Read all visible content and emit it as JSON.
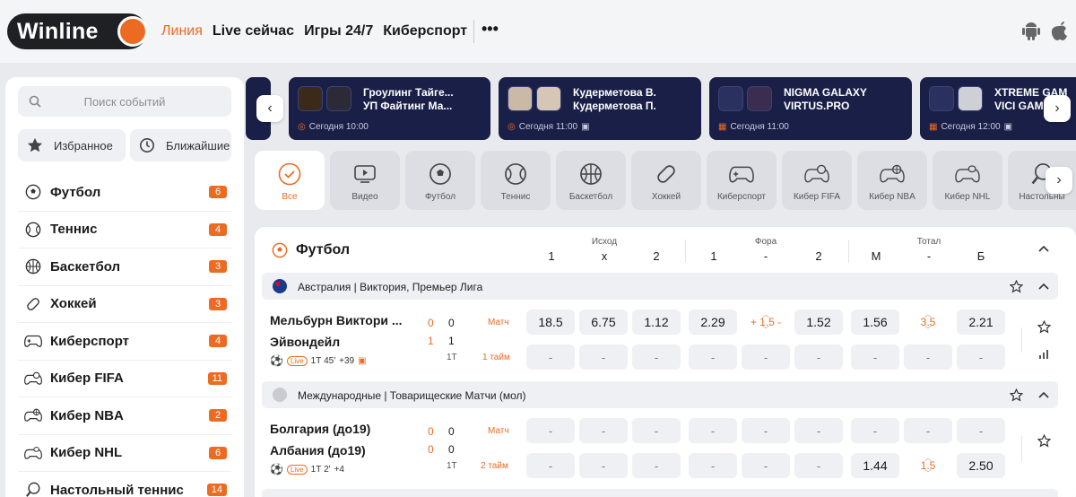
{
  "header": {
    "logo": "Winline",
    "nav": [
      {
        "label": "Линия",
        "active": true
      },
      {
        "label": "Live сейчас",
        "active": false
      },
      {
        "label": "Игры 24/7",
        "active": false
      },
      {
        "label": "Киберспорт",
        "active": false
      }
    ],
    "more": "•••",
    "accent": "#ec6b23"
  },
  "sidebar": {
    "search_placeholder": "Поиск событий",
    "favorites": "Избранное",
    "upcoming": "Ближайшие",
    "sports": [
      {
        "label": "Футбол",
        "count": "6",
        "icon": "soccer-ball-icon"
      },
      {
        "label": "Теннис",
        "count": "4",
        "icon": "tennis-ball-icon"
      },
      {
        "label": "Баскетбол",
        "count": "3",
        "icon": "basketball-icon"
      },
      {
        "label": "Хоккей",
        "count": "3",
        "icon": "hockey-puck-icon"
      },
      {
        "label": "Киберспорт",
        "count": "4",
        "icon": "gamepad-icon"
      },
      {
        "label": "Кибер FIFA",
        "count": "11",
        "icon": "cyber-fifa-icon"
      },
      {
        "label": "Кибер NBA",
        "count": "2",
        "icon": "cyber-nba-icon"
      },
      {
        "label": "Кибер NHL",
        "count": "6",
        "icon": "cyber-nhl-icon"
      },
      {
        "label": "Настольный теннис",
        "count": "14",
        "icon": "table-tennis-icon"
      }
    ]
  },
  "top_events": [
    {
      "line1": "Гроулинг Тайге...",
      "line2": "УП Файтинг Ма...",
      "time": "Сегодня 10:00"
    },
    {
      "line1": "Кудерметова В.",
      "line2": "Кудерметова П.",
      "time": "Сегодня 11:00"
    },
    {
      "line1": "NIGMA GALAXY",
      "line2": "VIRTUS.PRO",
      "time": "Сегодня 11:00"
    },
    {
      "line1": "XTREME GAM",
      "line2": "VICI GAM",
      "time": "Сегодня 12:00"
    }
  ],
  "tabs": [
    {
      "label": "Все",
      "active": true
    },
    {
      "label": "Видео"
    },
    {
      "label": "Футбол"
    },
    {
      "label": "Теннис"
    },
    {
      "label": "Баскетбол"
    },
    {
      "label": "Хоккей"
    },
    {
      "label": "Киберспорт"
    },
    {
      "label": "Кибер FIFA"
    },
    {
      "label": "Кибер NBA"
    },
    {
      "label": "Кибер NHL"
    },
    {
      "label": "Настольны"
    }
  ],
  "board": {
    "title": "Футбол",
    "groups": {
      "outcome": "Исход",
      "handicap": "Фора",
      "total": "Тотал"
    },
    "cols": {
      "c1": "1",
      "cx": "x",
      "c2": "2",
      "f1": "1",
      "fdash": "-",
      "f2": "2",
      "tm": "М",
      "tdash": "-",
      "tb": "Б"
    },
    "leagues": [
      {
        "name": "Австралия | Виктория, Премьер Лига",
        "match": {
          "team1": "Мельбурн Виктори ...",
          "team2": "Эйвондейл",
          "score1_half": "0",
          "score1": "0",
          "score2_half": "1",
          "score2": "1",
          "period": "1Т",
          "time": "1Т 45'",
          "extra": "+39",
          "row1_label": "Матч",
          "row2_label": "1 тайм",
          "row1": {
            "c1": "18.5",
            "cx": "6.75",
            "c2": "1.12",
            "f1": "2.29",
            "fline": "+ 1.5 -",
            "f2": "1.52",
            "tm": "1.56",
            "tline": "3.5",
            "tb": "2.21"
          },
          "row2": {
            "c1": "-",
            "cx": "-",
            "c2": "-",
            "f1": "-",
            "fline": "-",
            "f2": "-",
            "tm": "-",
            "tline": "-",
            "tb": "-"
          }
        }
      },
      {
        "name": "Международные | Товарищеские Матчи (мол)",
        "match": {
          "team1": "Болгария (до19)",
          "team2": "Албания (до19)",
          "score1_half": "0",
          "score1": "0",
          "score2_half": "0",
          "score2": "0",
          "period": "1Т",
          "time": "1Т 2'",
          "extra": "+4",
          "row1_label": "Матч",
          "row2_label": "2 тайм",
          "row1": {
            "c1": "-",
            "cx": "-",
            "c2": "-",
            "f1": "-",
            "fline": "-",
            "f2": "-",
            "tm": "-",
            "tline": "-",
            "tb": "-"
          },
          "row2": {
            "c1": "-",
            "cx": "-",
            "c2": "-",
            "f1": "-",
            "fline": "-",
            "f2": "-",
            "tm": "1.44",
            "tline": "1.5",
            "tb": "2.50"
          }
        }
      }
    ]
  }
}
